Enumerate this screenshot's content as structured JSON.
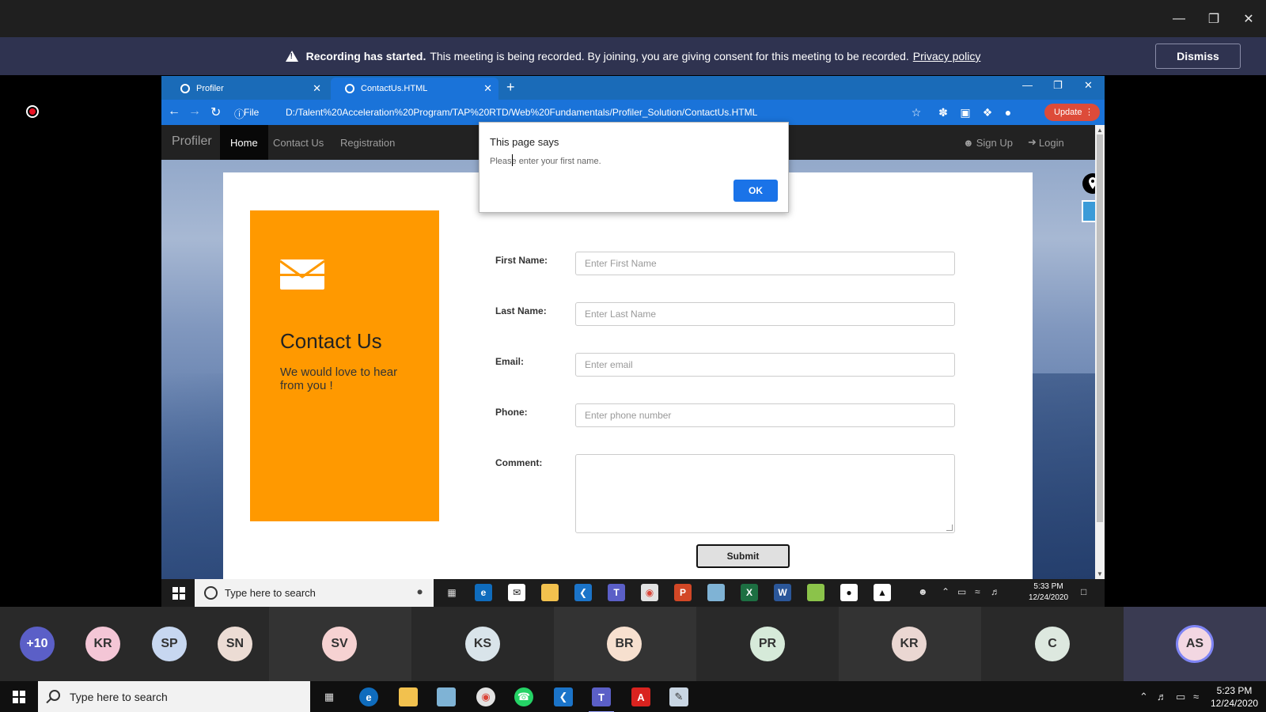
{
  "banner": {
    "bold": "Recording has started.",
    "text": "This meeting is being recorded. By joining, you are giving consent for this meeting to be recorded.",
    "link": "Privacy policy",
    "dismiss": "Dismiss"
  },
  "browser": {
    "tabs": [
      {
        "label": "Profiler"
      },
      {
        "label": "ContactUs.HTML"
      }
    ],
    "file_label": "File",
    "url": "D:/Talent%20Acceleration%20Program/TAP%20RTD/Web%20Fundamentals/Profiler_Solution/ContactUs.HTML",
    "update_label": "Update"
  },
  "site": {
    "brand": "Profiler",
    "nav": [
      "Home",
      "Contact Us",
      "Registration"
    ],
    "signup": "Sign Up",
    "login": "Login"
  },
  "contact": {
    "title": "Contact Us",
    "subtitle": "We would love to hear from you !"
  },
  "form": {
    "first_name": {
      "label": "First Name:",
      "placeholder": "Enter First Name"
    },
    "last_name": {
      "label": "Last Name:",
      "placeholder": "Enter Last Name"
    },
    "email": {
      "label": "Email:",
      "placeholder": "Enter email"
    },
    "phone": {
      "label": "Phone:",
      "placeholder": "Enter phone number"
    },
    "comment": {
      "label": "Comment:"
    },
    "submit": "Submit"
  },
  "alert": {
    "title": "This page says",
    "message": "Please enter your first name.",
    "ok": "OK"
  },
  "remote_taskbar": {
    "search": "Type here to search",
    "time": "5:33 PM",
    "date": "12/24/2020"
  },
  "participants": [
    {
      "initials": "+10",
      "color": "#5b5fc7"
    },
    {
      "initials": "KR",
      "color": "#f4c6d6"
    },
    {
      "initials": "SP",
      "color": "#c7d7f0"
    },
    {
      "initials": "SN",
      "color": "#ecdcd4"
    },
    {
      "initials": "SV",
      "color": "#f6d2d2"
    },
    {
      "initials": "KS",
      "color": "#d9e4ea"
    },
    {
      "initials": "BR",
      "color": "#f7e0cf"
    },
    {
      "initials": "PR",
      "color": "#d6ead9"
    },
    {
      "initials": "KR",
      "color": "#ead7d2"
    },
    {
      "initials": "C",
      "color": "#dde8df"
    },
    {
      "initials": "AS",
      "color": "#f3d7e2"
    }
  ],
  "taskbar": {
    "search": "Type here to search",
    "time": "5:23 PM",
    "date": "12/24/2020"
  }
}
